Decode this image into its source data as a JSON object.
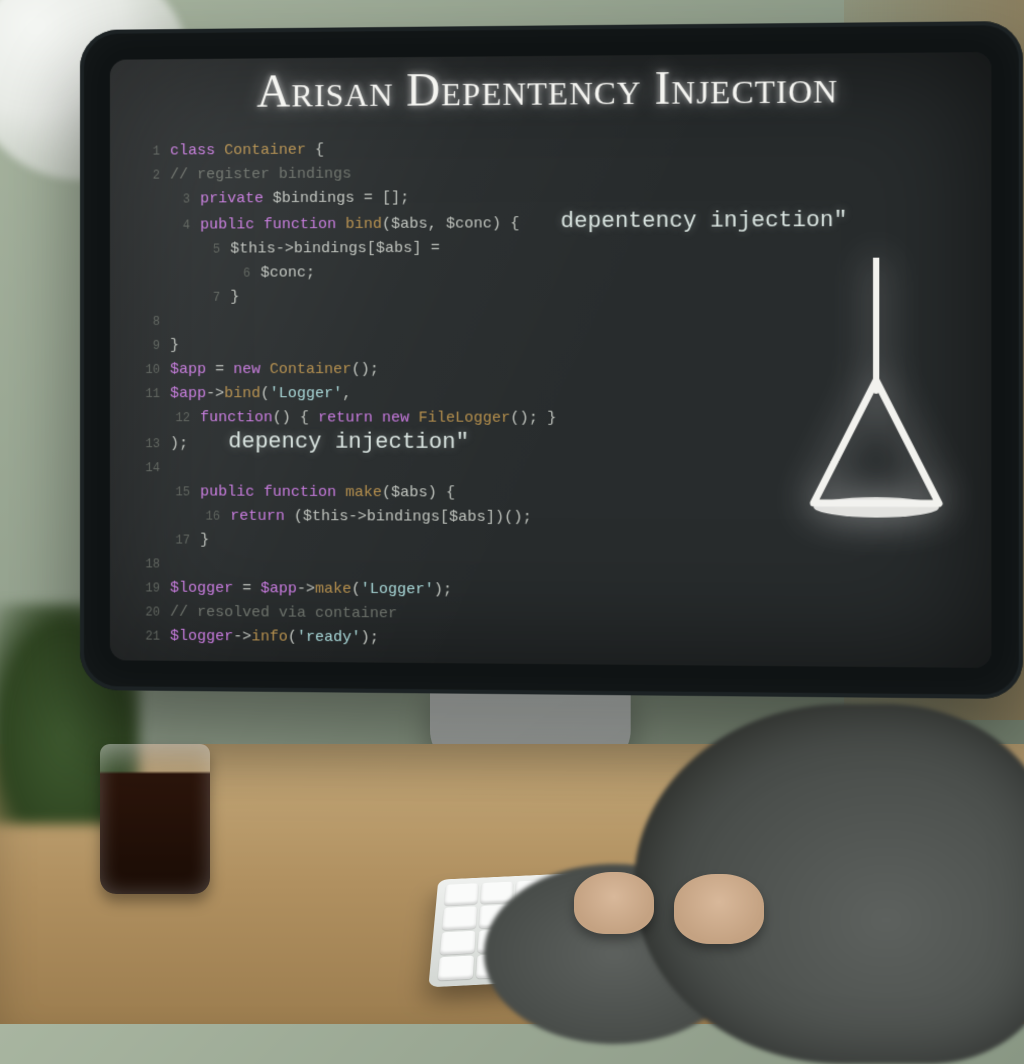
{
  "screen": {
    "title": "Arisan Depentency Injection",
    "annotation_1": "depentency injection\"",
    "annotation_2": "depency injection\"",
    "lines": [
      {
        "ln": "1",
        "indent": 0,
        "frags": [
          {
            "cls": "kw",
            "t": "class"
          },
          {
            "cls": "",
            "t": " "
          },
          {
            "cls": "fn",
            "t": "Container"
          },
          {
            "cls": "",
            "t": " {"
          }
        ]
      },
      {
        "ln": "2",
        "indent": 0,
        "frags": [
          {
            "cls": "cmt",
            "t": "// register bindings"
          }
        ]
      },
      {
        "ln": "3",
        "indent": 1,
        "frags": [
          {
            "cls": "kw",
            "t": "private"
          },
          {
            "cls": "",
            "t": " $bindings = [];"
          }
        ]
      },
      {
        "ln": "4",
        "indent": 1,
        "frags": [
          {
            "cls": "kw",
            "t": "public function"
          },
          {
            "cls": "",
            "t": " "
          },
          {
            "cls": "fn",
            "t": "bind"
          },
          {
            "cls": "",
            "t": "($abs, $conc) {"
          }
        ]
      },
      {
        "ln": "5",
        "indent": 2,
        "frags": [
          {
            "cls": "",
            "t": "$this->bindings[$abs] ="
          }
        ]
      },
      {
        "ln": "6",
        "indent": 3,
        "frags": [
          {
            "cls": "",
            "t": "$conc;"
          }
        ]
      },
      {
        "ln": "7",
        "indent": 2,
        "frags": [
          {
            "cls": "",
            "t": "}"
          }
        ]
      },
      {
        "ln": "8",
        "indent": 0,
        "frags": [
          {
            "cls": "",
            "t": ""
          }
        ]
      },
      {
        "ln": "9",
        "indent": 0,
        "frags": [
          {
            "cls": "",
            "t": "}"
          }
        ]
      },
      {
        "ln": "10",
        "indent": 0,
        "frags": [
          {
            "cls": "kw",
            "t": "$app"
          },
          {
            "cls": "",
            "t": " = "
          },
          {
            "cls": "kw",
            "t": "new"
          },
          {
            "cls": "",
            "t": " "
          },
          {
            "cls": "fn",
            "t": "Container"
          },
          {
            "cls": "",
            "t": "();"
          }
        ]
      },
      {
        "ln": "11",
        "indent": 0,
        "frags": [
          {
            "cls": "kw",
            "t": "$app"
          },
          {
            "cls": "",
            "t": "->"
          },
          {
            "cls": "fn",
            "t": "bind"
          },
          {
            "cls": "",
            "t": "("
          },
          {
            "cls": "str",
            "t": "'Logger'"
          },
          {
            "cls": "",
            "t": ","
          }
        ]
      },
      {
        "ln": "12",
        "indent": 1,
        "frags": [
          {
            "cls": "kw",
            "t": "function"
          },
          {
            "cls": "",
            "t": "() { "
          },
          {
            "cls": "kw",
            "t": "return new"
          },
          {
            "cls": "",
            "t": " "
          },
          {
            "cls": "fn",
            "t": "FileLogger"
          },
          {
            "cls": "",
            "t": "(); }"
          }
        ]
      },
      {
        "ln": "13",
        "indent": 0,
        "frags": [
          {
            "cls": "",
            "t": ");"
          }
        ]
      },
      {
        "ln": "14",
        "indent": 0,
        "frags": [
          {
            "cls": "",
            "t": ""
          }
        ]
      },
      {
        "ln": "15",
        "indent": 1,
        "frags": [
          {
            "cls": "kw",
            "t": "public function"
          },
          {
            "cls": "",
            "t": " "
          },
          {
            "cls": "fn",
            "t": "make"
          },
          {
            "cls": "",
            "t": "($abs) {"
          }
        ]
      },
      {
        "ln": "16",
        "indent": 2,
        "frags": [
          {
            "cls": "kw",
            "t": "return"
          },
          {
            "cls": "",
            "t": " ($this->bindings[$abs])();"
          }
        ]
      },
      {
        "ln": "17",
        "indent": 1,
        "frags": [
          {
            "cls": "",
            "t": "}"
          }
        ]
      },
      {
        "ln": "18",
        "indent": 0,
        "frags": [
          {
            "cls": "",
            "t": ""
          }
        ]
      },
      {
        "ln": "19",
        "indent": 0,
        "frags": [
          {
            "cls": "kw",
            "t": "$logger"
          },
          {
            "cls": "",
            "t": " = "
          },
          {
            "cls": "kw",
            "t": "$app"
          },
          {
            "cls": "",
            "t": "->"
          },
          {
            "cls": "fn",
            "t": "make"
          },
          {
            "cls": "",
            "t": "("
          },
          {
            "cls": "str",
            "t": "'Logger'"
          },
          {
            "cls": "",
            "t": ");"
          }
        ]
      },
      {
        "ln": "20",
        "indent": 0,
        "frags": [
          {
            "cls": "cmt",
            "t": "// resolved via container"
          }
        ]
      },
      {
        "ln": "21",
        "indent": 0,
        "frags": [
          {
            "cls": "kw",
            "t": "$logger"
          },
          {
            "cls": "",
            "t": "->"
          },
          {
            "cls": "fn",
            "t": "info"
          },
          {
            "cls": "",
            "t": "("
          },
          {
            "cls": "str",
            "t": "'ready'"
          },
          {
            "cls": "",
            "t": ");"
          }
        ]
      }
    ]
  }
}
